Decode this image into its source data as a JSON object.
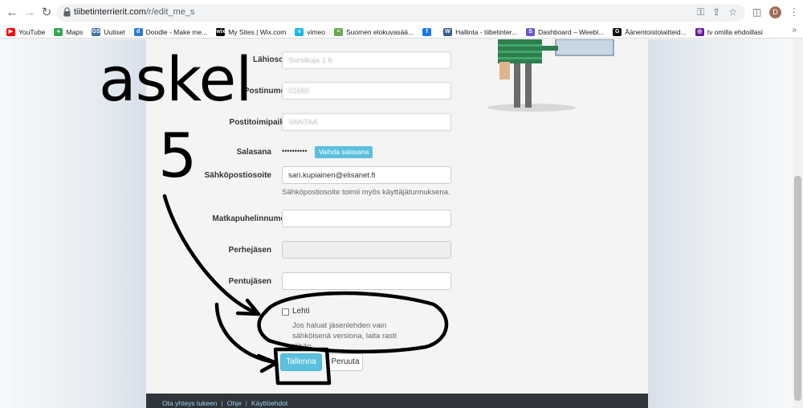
{
  "browser": {
    "url_domain": "tiibetinterrierit.com",
    "url_path": "/r/edit_me_s",
    "avatar_letter": "D",
    "bookmarks": [
      {
        "label": "YouTube",
        "color": "#ff0000",
        "glyph": "▶"
      },
      {
        "label": "Maps",
        "color": "#34a853",
        "glyph": "●"
      },
      {
        "label": "Uutiset",
        "color": "#4a6fa5",
        "glyph": "GS"
      },
      {
        "label": "Doodle - Make me...",
        "color": "#2a7ae2",
        "glyph": "d"
      },
      {
        "label": "My Sites | Wix.com",
        "color": "#000000",
        "glyph": "wix"
      },
      {
        "label": "vimeo",
        "color": "#1ab7ea",
        "glyph": "v"
      },
      {
        "label": "Suomen elokuvasää...",
        "color": "#6aa84f",
        "glyph": "≡"
      },
      {
        "label": "",
        "color": "#1877f2",
        "glyph": "f"
      },
      {
        "label": "Hallinta - tiibetinter...",
        "color": "#3b5e8a",
        "glyph": "W"
      },
      {
        "label": "Dashboard – Weebl...",
        "color": "#6b55c7",
        "glyph": "S"
      },
      {
        "label": "Äänentoistolaitteid...",
        "color": "#111111",
        "glyph": "G"
      },
      {
        "label": "tv omilla ehdoillasi",
        "color": "#6a1b9a",
        "glyph": "◎"
      }
    ],
    "more_label": "»"
  },
  "form": {
    "street": {
      "label": "Lähiosoite",
      "value": "Sorsikuja 1 b"
    },
    "postcode": {
      "label": "Postinumero",
      "value": "01650"
    },
    "city": {
      "label": "Postitoimipaikka",
      "value": "VANTAA"
    },
    "password": {
      "label": "Salasana",
      "mask": "••••••••••",
      "change_label": "Vaihda salasana"
    },
    "email": {
      "label": "Sähköpostiosoite",
      "value": "sari.kupiainen@elisanet.fi",
      "help": "Sähköpostiosoite toimii myös käyttäjätunnuksena."
    },
    "mobile": {
      "label": "Matkapuhelinnumero",
      "value": ""
    },
    "family_member": {
      "label": "Perhejäsen",
      "value": ""
    },
    "puppy_member": {
      "label": "Pentujäsen",
      "value": ""
    },
    "magazine": {
      "label": "Lehti",
      "checked": false,
      "help": "Jos haluat jäsenlehden vain sähköisenä versiona, laita rasti tähän."
    },
    "save_label": "Tallenna",
    "cancel_label": "Peruuta"
  },
  "footer": {
    "links": [
      "Ota yhteys tukeen",
      "Ohje",
      "Käyttöehdot"
    ],
    "separator": "|"
  },
  "annotation": {
    "word": "askel",
    "number": "5"
  }
}
